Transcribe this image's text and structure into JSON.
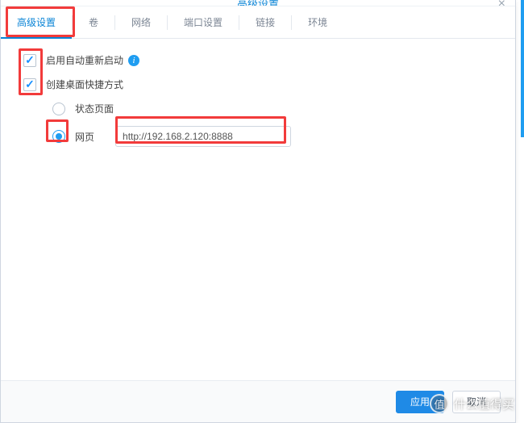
{
  "modal": {
    "title": "高级设置",
    "close_symbol": "×"
  },
  "tabs": {
    "advanced": "高级设置",
    "volume": "卷",
    "network": "网络",
    "port": "端口设置",
    "link": "链接",
    "env": "环境"
  },
  "options": {
    "auto_restart_label": "启用自动重新启动",
    "desktop_shortcut_label": "创建桌面快捷方式",
    "status_page_label": "状态页面",
    "web_page_label": "网页",
    "url_value": "http://192.168.2.120:8888"
  },
  "footer": {
    "apply": "应用",
    "cancel": "取消"
  },
  "watermark": {
    "badge": "值",
    "text": "什么值得买"
  }
}
